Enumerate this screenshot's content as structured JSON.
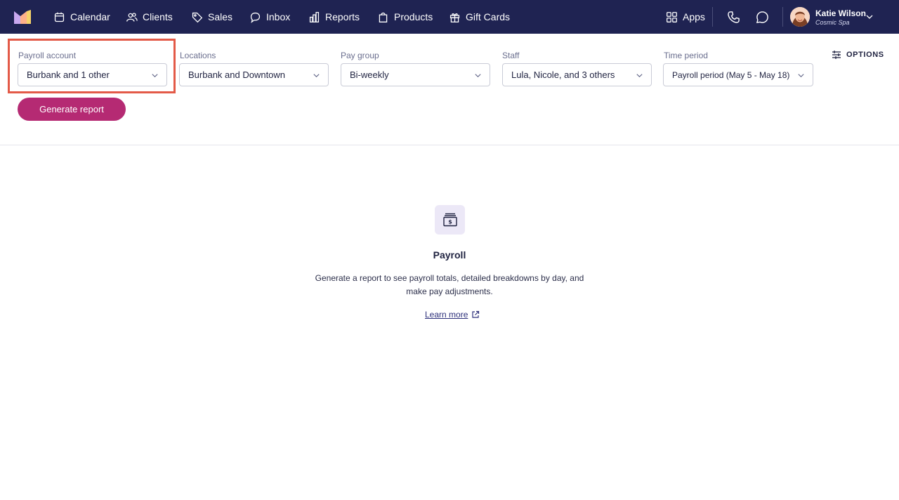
{
  "nav": {
    "items": [
      {
        "label": "Calendar",
        "icon": "calendar-icon"
      },
      {
        "label": "Clients",
        "icon": "users-icon"
      },
      {
        "label": "Sales",
        "icon": "tag-icon"
      },
      {
        "label": "Inbox",
        "icon": "chat-bubble-icon"
      },
      {
        "label": "Reports",
        "icon": "bar-chart-icon"
      },
      {
        "label": "Products",
        "icon": "shopping-bag-icon"
      },
      {
        "label": "Gift Cards",
        "icon": "gift-icon"
      },
      {
        "label": "Apps",
        "icon": "apps-grid-icon"
      }
    ],
    "user": {
      "name": "Katie Wilson",
      "org": "Cosmic Spa"
    }
  },
  "filters": {
    "payroll_account": {
      "label": "Payroll account",
      "value": "Burbank and 1 other"
    },
    "locations": {
      "label": "Locations",
      "value": "Burbank and Downtown"
    },
    "pay_group": {
      "label": "Pay group",
      "value": "Bi-weekly"
    },
    "staff": {
      "label": "Staff",
      "value": "Lula, Nicole, and 3 others"
    },
    "time_period": {
      "label": "Time period",
      "value": "Payroll period (May 5 - May 18)"
    }
  },
  "options_label": "OPTIONS",
  "generate_label": "Generate report",
  "empty": {
    "title": "Payroll",
    "text": "Generate a report to see payroll totals, detailed breakdowns by day, and make pay adjustments.",
    "link": "Learn more"
  },
  "colors": {
    "nav_bg": "#1f2352",
    "accent": "#b52a73",
    "highlight": "#e35a48"
  }
}
